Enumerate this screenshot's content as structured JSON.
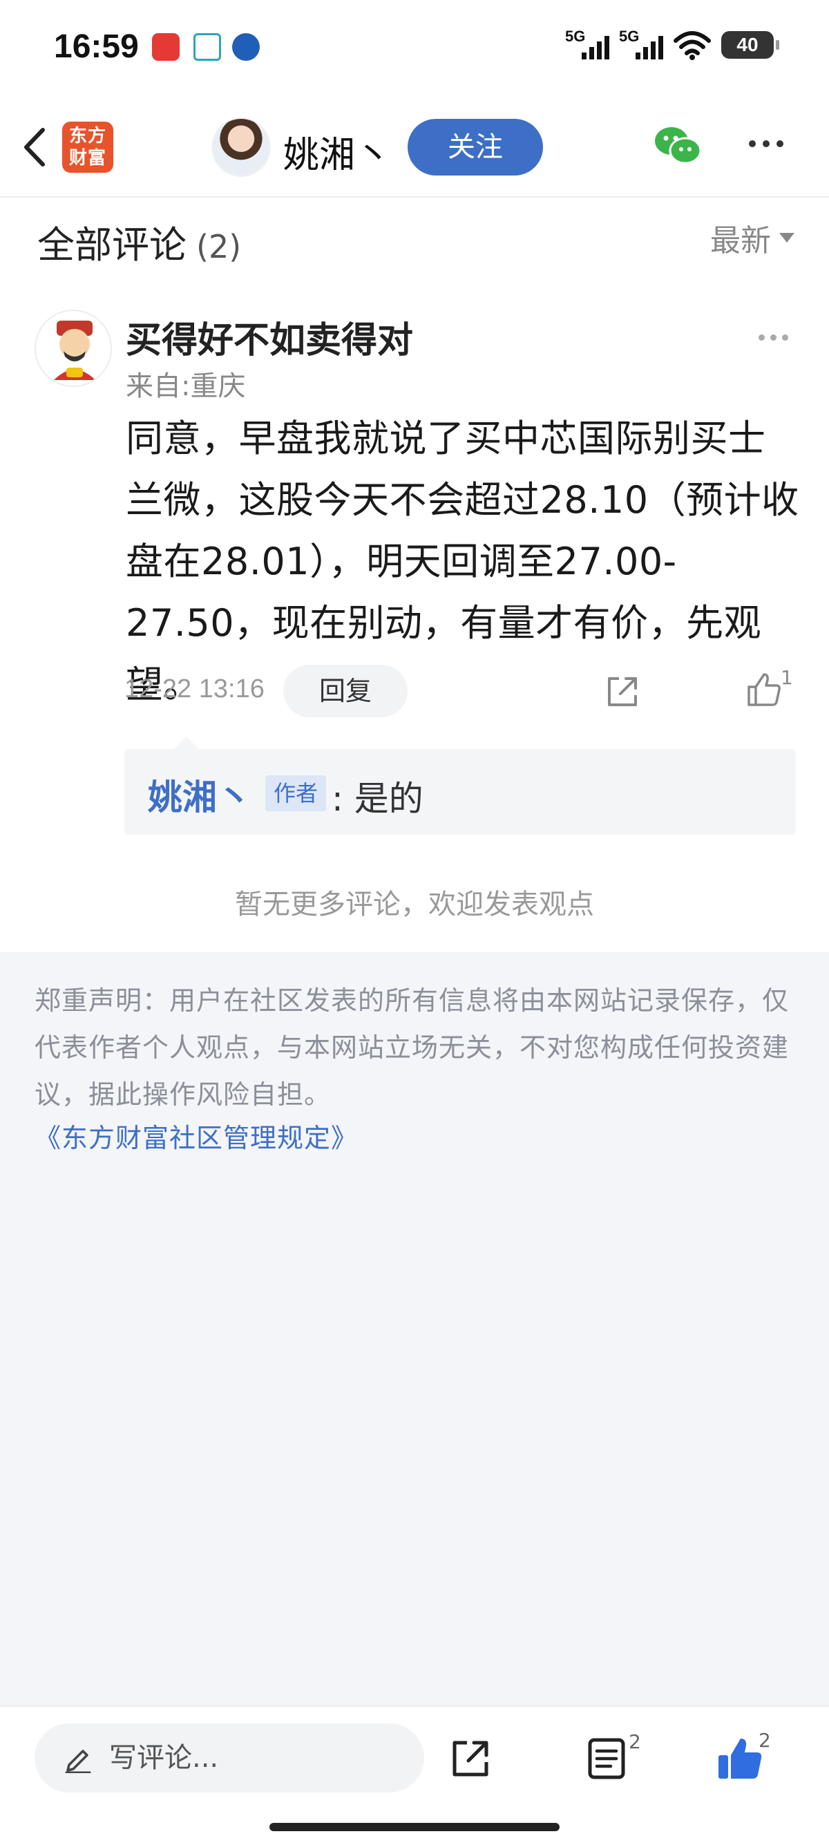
{
  "status_bar": {
    "time": "16:59",
    "signal_1_label": "5G",
    "signal_2_label": "5G",
    "battery": "40",
    "icons": [
      "red-app-icon",
      "home-app-icon",
      "blue-app-icon",
      "signal-icon",
      "signal-icon",
      "wifi-icon",
      "battery-icon"
    ]
  },
  "nav": {
    "brand_line1": "东方",
    "brand_line2": "财富",
    "username": "姚湘丶",
    "follow_label": "关注",
    "accent_color": "#3e6fc6"
  },
  "comments": {
    "title": "全部评论",
    "count": "(2)",
    "sort_label": "最新"
  },
  "comment": {
    "username": "买得好不如卖得对",
    "location": "来自:重庆",
    "body": "同意，早盘我就说了买中芯国际别买士兰微，这股今天不会超过28.10（预计收盘在28.01），明天回调至27.00-27.50，现在别动，有量才有价，先观望。",
    "time": "12-22 13:16",
    "reply_label": "回复",
    "like_count": "1"
  },
  "reply": {
    "author": "姚湘丶",
    "author_tag": "作者",
    "text": ": 是的"
  },
  "no_more_text": "暂无更多评论，欢迎发表观点",
  "disclaimer": {
    "text": "郑重声明：用户在社区发表的所有信息将由本网站记录保存，仅代表作者个人观点，与本网站立场无关，不对您构成任何投资建议，据此操作风险自担。",
    "link": "《东方财富社区管理规定》"
  },
  "bottom_bar": {
    "comment_placeholder": "写评论...",
    "list_count": "2",
    "like_count": "2"
  }
}
